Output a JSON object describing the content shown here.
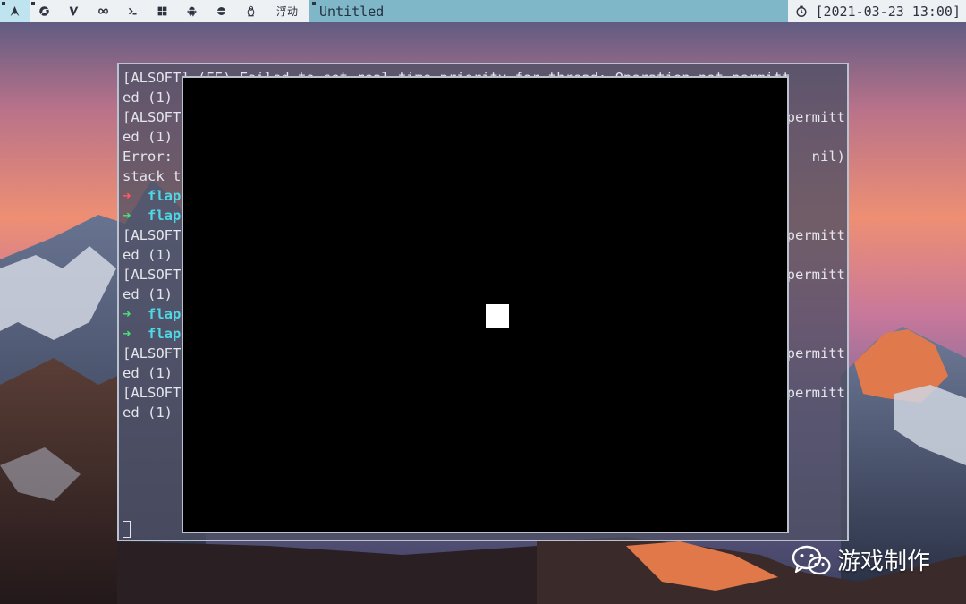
{
  "topbar": {
    "workspaces": [
      {
        "icon": "arch-logo-icon",
        "active": true
      },
      {
        "icon": "chrome-icon"
      },
      {
        "icon": "vim-icon"
      },
      {
        "icon": "infinity-icon"
      },
      {
        "icon": "terminal-prompt-icon"
      },
      {
        "icon": "windows-logo-icon"
      },
      {
        "icon": "android-icon"
      },
      {
        "icon": "circle-slot-icon"
      },
      {
        "icon": "linux-penguin-icon"
      }
    ],
    "layout_label": "浮动",
    "window_title": "Untitled",
    "clock_icon": "clock-icon",
    "clock": "[2021-03-23 13:00]"
  },
  "terminal": {
    "lines": [
      {
        "text": "[ALSOFT] (EE) Failed to set real-time priority for thread: Operation not permitt"
      },
      {
        "text": "ed (1)"
      },
      {
        "text": "[ALSOFT"
      },
      {
        "right": "permitt"
      },
      {
        "text": "ed (1)"
      },
      {
        "text": "Error: "
      },
      {
        "right": "nil)"
      },
      {
        "text": "stack t"
      },
      {
        "arrow": "➜",
        "arrow_color": "red",
        "cmd": "flap"
      },
      {
        "arrow": "➜",
        "arrow_color": "green",
        "cmd": "flap"
      },
      {
        "text": "[ALSOFT"
      },
      {
        "right": "permitt"
      },
      {
        "text": "ed (1)"
      },
      {
        "text": "[ALSOFT"
      },
      {
        "right": "permitt"
      },
      {
        "text": "ed (1)"
      },
      {
        "arrow": "➜",
        "arrow_color": "green",
        "cmd": "flap"
      },
      {
        "arrow": "➜",
        "arrow_color": "green",
        "cmd": "flap"
      },
      {
        "text": "[ALSOFT"
      },
      {
        "right": "permitt"
      },
      {
        "text": "ed (1)"
      },
      {
        "text": "[ALSOFT"
      },
      {
        "right": "permitt"
      },
      {
        "text": "ed (1)"
      }
    ]
  },
  "game": {
    "background": "#000000",
    "player_color": "#ffffff"
  },
  "watermark": {
    "icon": "wechat-icon",
    "text": "游戏制作"
  },
  "colors": {
    "topbar_accent": "#7fb7c9",
    "prompt_red": "#ff5c5c",
    "prompt_green": "#44e47a",
    "command_cyan": "#4fd8e4"
  }
}
